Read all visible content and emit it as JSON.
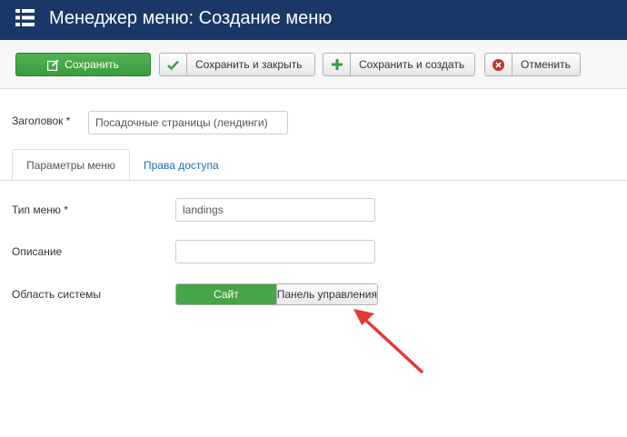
{
  "header": {
    "title": "Менеджер меню: Создание меню",
    "menu_icon": "list-icon"
  },
  "toolbar": {
    "save": {
      "label": "Сохранить",
      "icon": "edit-icon"
    },
    "save_close": {
      "label": "Сохранить и закрыть",
      "icon": "check-icon"
    },
    "save_new": {
      "label": "Сохранить и создать",
      "icon": "plus-icon"
    },
    "cancel": {
      "label": "Отменить",
      "icon": "cancel-circle-icon"
    }
  },
  "form": {
    "title_label": "Заголовок *",
    "title_value": "Посадочные страницы (лендинги)"
  },
  "tabs": [
    {
      "label": "Параметры меню",
      "active": true
    },
    {
      "label": "Права доступа",
      "active": false
    }
  ],
  "fields": {
    "menu_type_label": "Тип меню *",
    "menu_type_value": "landings",
    "description_label": "Описание",
    "description_value": "",
    "client_label": "Область системы",
    "client_options": [
      "Сайт",
      "Панель управления"
    ],
    "client_selected": "Сайт"
  },
  "colors": {
    "header_bg": "#1a3867",
    "save_green": "#46a546",
    "tab_link": "#1f6fb2",
    "annotation_arrow": "#e53935"
  }
}
